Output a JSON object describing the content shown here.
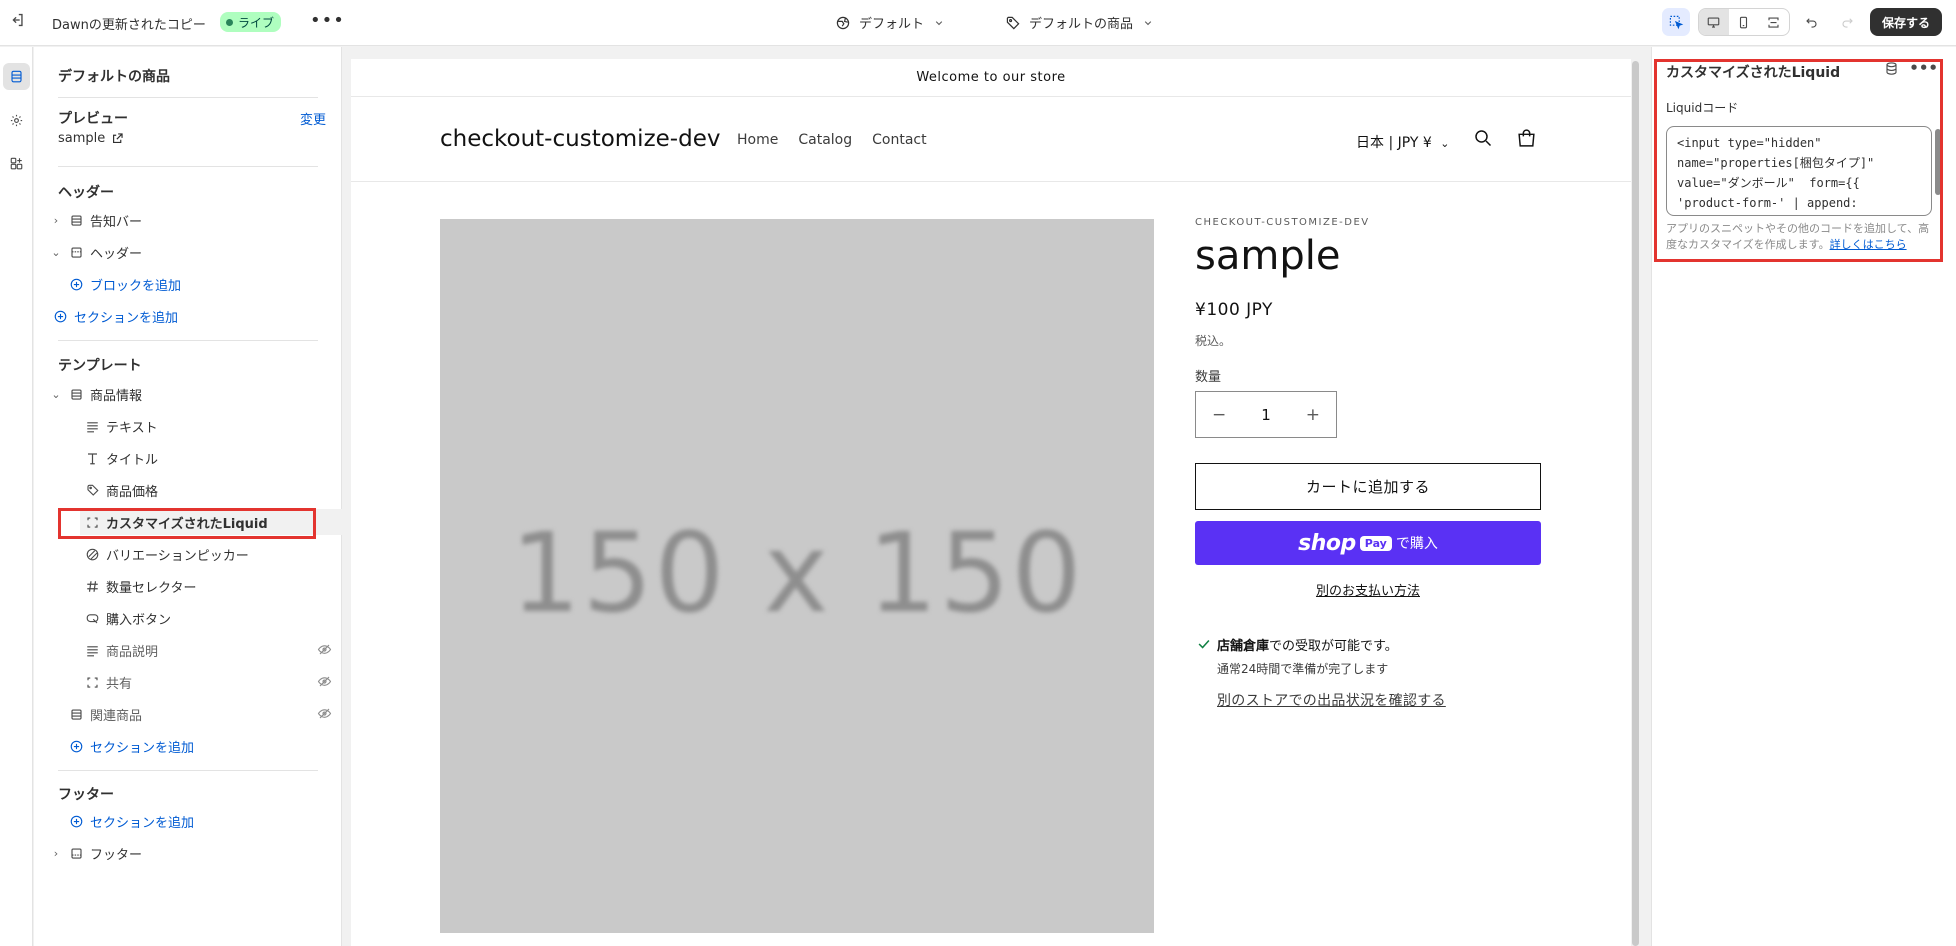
{
  "topbar": {
    "theme_name": "Dawnの更新されたコピー",
    "status_badge": "ライブ",
    "more": "•••",
    "theme_selector": "デフォルト",
    "template_selector": "デフォルトの商品",
    "save_label": "保存する"
  },
  "sidebar": {
    "title": "デフォルトの商品",
    "preview_heading": "プレビュー",
    "preview_change": "変更",
    "preview_value": "sample",
    "header_group": {
      "heading": "ヘッダー",
      "items": [
        {
          "label": "告知バー"
        },
        {
          "label": "ヘッダー"
        },
        {
          "label": "ブロックを追加"
        },
        {
          "label": "セクションを追加"
        }
      ]
    },
    "template_group": {
      "heading": "テンプレート",
      "section": "商品情報",
      "blocks": [
        {
          "label": "テキスト"
        },
        {
          "label": "タイトル"
        },
        {
          "label": "商品価格"
        },
        {
          "label": "カスタマイズされたLiquid"
        },
        {
          "label": "バリエーションピッカー"
        },
        {
          "label": "数量セレクター"
        },
        {
          "label": "購入ボタン"
        },
        {
          "label": "商品説明"
        },
        {
          "label": "共有"
        }
      ],
      "related": "関連商品",
      "add_section": "セクションを追加"
    },
    "footer_group": {
      "heading": "フッター",
      "add_section": "セクションを追加",
      "footer": "フッター"
    }
  },
  "preview": {
    "announcement": "Welcome to our store",
    "store_name": "checkout-customize-dev",
    "nav": [
      "Home",
      "Catalog",
      "Contact"
    ],
    "currency": "日本 | JPY ¥",
    "image_placeholder": "150 x 150",
    "vendor": "CHECKOUT-CUSTOMIZE-DEV",
    "product_title": "sample",
    "price": "¥100 JPY",
    "tax_note": "税込。",
    "quantity_label": "数量",
    "quantity_value": "1",
    "quantity_minus": "−",
    "quantity_plus": "+",
    "add_to_cart": "カートに追加する",
    "shop_pay_word": "shop",
    "shop_pay_badge": "Pay",
    "shop_pay_suffix": "で購入",
    "more_payment": "別のお支払い方法",
    "pickup_location": "店舗倉庫",
    "pickup_available": "での受取が可能です。",
    "pickup_time": "通常24時間で準備が完了します",
    "pickup_link": "別のストアでの出品状況を確認する"
  },
  "settings_panel": {
    "title": "カスタマイズされたLiquid",
    "code_label": "Liquidコード",
    "code": "<input type=\"hidden\"\nname=\"properties[梱包タイプ]\"\nvalue=\"ダンボール\"  form={{\n'product-form-' | append:",
    "help_text": "アプリのスニペットやその他のコードを追加して、高度なカスタマイズを作成します。",
    "help_link": "詳しくはこちら"
  },
  "colors": {
    "accent": "#005bd3",
    "shop_pay": "#5a31f4",
    "live_badge": "#affebf",
    "highlight": "#e3342f"
  }
}
